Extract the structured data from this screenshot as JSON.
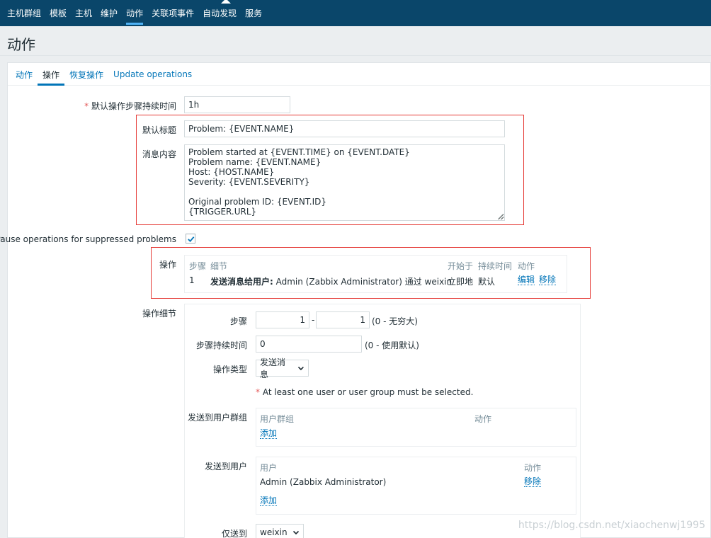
{
  "topnav": {
    "items": [
      "主机群组",
      "模板",
      "主机",
      "维护",
      "动作",
      "关联项事件",
      "自动发现",
      "服务"
    ],
    "active_index": 4
  },
  "page": {
    "title": "动作"
  },
  "tabs": [
    "动作",
    "操作",
    "恢复操作",
    "Update operations"
  ],
  "tabs_active_index": 1,
  "form": {
    "default_step_duration_label": "默认操作步骤持续时间",
    "default_step_duration_value": "1h",
    "default_subject_label": "默认标题",
    "default_subject_value": "Problem: {EVENT.NAME}",
    "default_message_label": "消息内容",
    "default_message_value": "Problem started at {EVENT.TIME} on {EVENT.DATE}\nProblem name: {EVENT.NAME}\nHost: {HOST.NAME}\nSeverity: {EVENT.SEVERITY}\n\nOriginal problem ID: {EVENT.ID}\n{TRIGGER.URL}",
    "pause_suppressed_label": "Pause operations for suppressed problems",
    "pause_suppressed_checked": true,
    "operations_label": "操作",
    "operations_table": {
      "headers": [
        "步骤",
        "细节",
        "开始于",
        "持续时间",
        "动作"
      ],
      "rows": [
        {
          "step": "1",
          "detail_bold": "发送消息给用户:",
          "detail_rest": " Admin (Zabbix Administrator) 通过 weixin",
          "start_in": "立即地",
          "duration": "默认",
          "edit": "编辑",
          "remove": "移除"
        }
      ]
    },
    "op_details_label": "操作细节",
    "op_details": {
      "steps_label": "步骤",
      "steps_from": "1",
      "steps_dash": "-",
      "steps_to": "1",
      "steps_hint": "(0 - 无穷大)",
      "step_duration_label": "步骤持续时间",
      "step_duration_value": "0",
      "step_duration_hint": "(0 - 使用默认)",
      "op_type_label": "操作类型",
      "op_type_value": "发送消息",
      "required_notice_star": "*",
      "required_notice": " At least one user or user group must be selected.",
      "send_to_groups_label": "发送到用户群组",
      "groups_headers": [
        "用户群组",
        "动作"
      ],
      "groups_add": "添加",
      "send_to_users_label": "发送到用户",
      "users_headers": [
        "用户",
        "动作"
      ],
      "users_rows": [
        {
          "name": "Admin (Zabbix Administrator)",
          "action": "移除"
        }
      ],
      "users_add": "添加",
      "send_only_to_label": "仅送到",
      "send_only_to_value": "weixin"
    }
  },
  "watermark": "https://blog.csdn.net/xiaochenwj1995",
  "colors": {
    "nav_bg": "#0a466a",
    "link": "#0275b8",
    "highlight_box": "#e53935"
  }
}
